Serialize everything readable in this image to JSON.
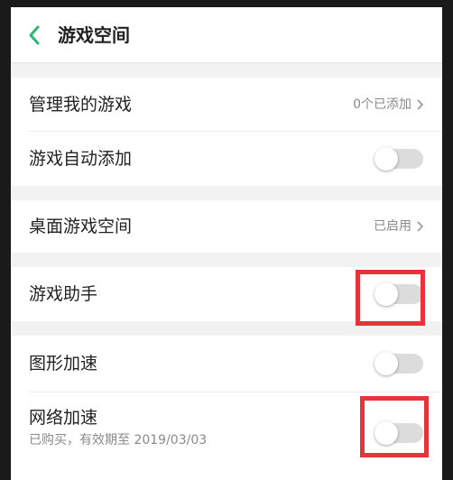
{
  "header": {
    "title": "游戏空间",
    "back_icon": "chevron-left-icon",
    "accent": "#2bb673"
  },
  "rows": {
    "manage_games": {
      "label": "管理我的游戏",
      "value": "0个已添加"
    },
    "auto_add": {
      "label": "游戏自动添加",
      "enabled": false
    },
    "desktop_space": {
      "label": "桌面游戏空间",
      "value": "已启用"
    },
    "game_assistant": {
      "label": "游戏助手",
      "enabled": false
    },
    "graphics_accel": {
      "label": "图形加速",
      "enabled": false
    },
    "network_accel": {
      "label": "网络加速",
      "sub": "已购买，有效期至 2019/03/03",
      "enabled": false
    }
  },
  "colors": {
    "highlight": "#e8333a",
    "toggle_off": "#dcdcdc"
  }
}
